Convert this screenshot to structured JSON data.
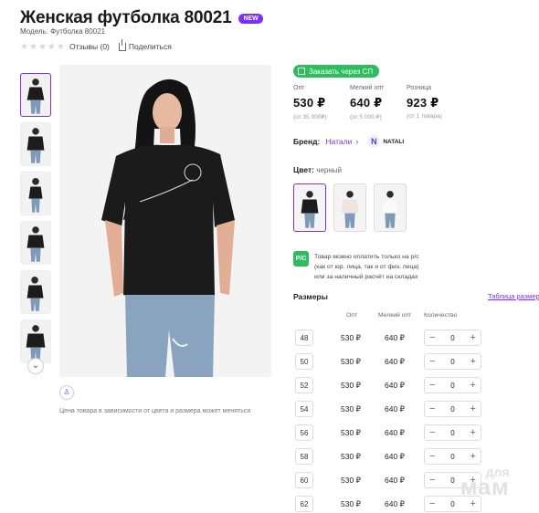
{
  "product": {
    "title": "Женская футболка 80021",
    "badge": "NEW",
    "model": "Модель: Футболка 80021",
    "reviews": "Отзывы (0)",
    "share": "Поделиться",
    "zoom_icon": "person-icon",
    "price_note": "Цена товара в зависимости от цвета и размера может меняться"
  },
  "purchase": {
    "sp_button": "Заказать через СП",
    "prices": [
      {
        "label": "Опт",
        "value": "530 ₽",
        "sub": "(от 35 000₽)"
      },
      {
        "label": "Мелкий опт",
        "value": "640 ₽",
        "sub": "(от 5 000 ₽)"
      },
      {
        "label": "Розница",
        "value": "923 ₽",
        "sub": "(от 1 товара)"
      }
    ]
  },
  "brand": {
    "label": "Бренд:",
    "name": "Натали",
    "logo_text": "NATALI",
    "logo_letter": "N"
  },
  "color": {
    "label": "Цвет:",
    "value": "черный"
  },
  "payment": {
    "icon_text": "Р/С",
    "line1": "Товар можно оплатить только на р/с",
    "line2": "(как от юр. лица, так и от физ. лица)",
    "line3": "или за наличный расчёт на складах"
  },
  "sizes": {
    "title": "Размеры",
    "table_link": "Таблица размеров",
    "headers": {
      "opt": "Опт",
      "small_opt": "Мелкий опт",
      "qty": "Количество"
    },
    "rows": [
      {
        "size": "48",
        "opt": "530 ₽",
        "small": "640 ₽",
        "qty": "0"
      },
      {
        "size": "50",
        "opt": "530 ₽",
        "small": "640 ₽",
        "qty": "0"
      },
      {
        "size": "52",
        "opt": "530 ₽",
        "small": "640 ₽",
        "qty": "0"
      },
      {
        "size": "54",
        "opt": "530 ₽",
        "small": "640 ₽",
        "qty": "0"
      },
      {
        "size": "56",
        "opt": "530 ₽",
        "small": "640 ₽",
        "qty": "0"
      },
      {
        "size": "58",
        "opt": "530 ₽",
        "small": "640 ₽",
        "qty": "0"
      },
      {
        "size": "60",
        "opt": "530 ₽",
        "small": "640 ₽",
        "qty": "0"
      },
      {
        "size": "62",
        "opt": "530 ₽",
        "small": "640 ₽",
        "qty": "0"
      }
    ],
    "minus": "−",
    "plus": "+"
  },
  "watermark": {
    "line1": "для",
    "line2": "мам"
  },
  "colors": {
    "accent": "#7b2ff7",
    "green": "#2ebd5e"
  }
}
